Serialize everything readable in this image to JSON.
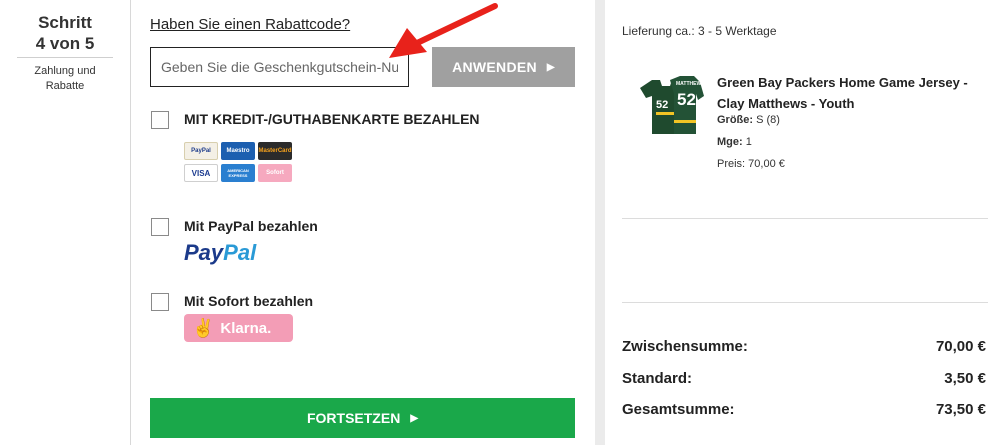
{
  "step": {
    "title_line1": "Schritt",
    "title_line2": "4 von 5",
    "subtitle_line1": "Zahlung und",
    "subtitle_line2": "Rabatte"
  },
  "coupon": {
    "link_text": "Haben Sie einen Rabattcode?",
    "placeholder": "Geben Sie die Geschenkgutschein-Nu",
    "apply_label": "ANWENDEN"
  },
  "payment_options": [
    {
      "label": "MIT KREDIT-/GUTHABENKARTE BEZAHLEN",
      "checked": false
    },
    {
      "label": "Mit PayPal bezahlen",
      "checked": false
    },
    {
      "label": "Mit Sofort bezahlen",
      "checked": false
    }
  ],
  "card_logos": {
    "paypal": "PayPal",
    "maestro": "Maestro",
    "mastercard": "MasterCard",
    "visa": "VISA",
    "amex": "AMERICAN EXPRESS",
    "sofort": "Sofort"
  },
  "paypal_logo": {
    "part1": "Pay",
    "part2": "Pal"
  },
  "klarna_logo": {
    "mark": "✌",
    "text": "Klarna."
  },
  "continue_label": "FORTSETZEN",
  "order": {
    "delivery": "Lieferung ca.: 3 - 5 Werktage",
    "product": {
      "name": "Green Bay Packers Home Game Jersey - Clay Matthews - Youth",
      "size_label": "Größe:",
      "size_value": "S (8)",
      "qty_label": "Mge:",
      "qty_value": "1",
      "price": "Preis: 70,00 €",
      "jersey_number": "52",
      "jersey_name": "MATTHEWS"
    },
    "totals": [
      {
        "label": "Zwischensumme:",
        "value": "70,00 €"
      },
      {
        "label": "Standard:",
        "value": "3,50 €"
      },
      {
        "label": "Gesamtsumme:",
        "value": "73,50 €"
      }
    ]
  },
  "colors": {
    "continue_green": "#1aa84a",
    "apply_gray": "#a0a0a0",
    "annotation_red": "#e8221b",
    "klarna_pink": "#f39db6",
    "jersey_green": "#1f4a2e"
  }
}
